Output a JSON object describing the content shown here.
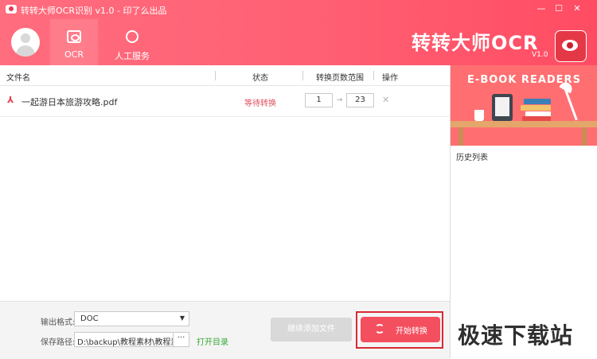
{
  "window": {
    "title": "转转大师OCR识别 v1.0 - 印了么出品",
    "controls": {
      "minimize": "—",
      "maximize": "☐",
      "close": "✕"
    }
  },
  "nav": {
    "items": [
      {
        "label": "OCR",
        "icon": "ocr-icon",
        "active": true
      },
      {
        "label": "人工服务",
        "icon": "customer-service-icon",
        "active": false
      }
    ]
  },
  "brand": {
    "name": "转转大师OCR",
    "version": "V1.0"
  },
  "table": {
    "headers": {
      "file_name": "文件名",
      "status": "状态",
      "page_range": "转换页数范围",
      "action": "操作"
    },
    "rows": [
      {
        "file_name": "一起游日本旅游攻略.pdf",
        "status": "等待转换",
        "page_from": "1",
        "page_to": "23"
      }
    ]
  },
  "settings": {
    "format_label": "输出格式:",
    "format_value": "DOC",
    "path_label": "保存路径:",
    "path_value": "D:\\backup\\教程素材\\教程素材",
    "path_more": "···",
    "open_dir": "打开目录"
  },
  "buttons": {
    "add_files": "继续添加文件",
    "start": "开始转换"
  },
  "side": {
    "banner_title": "E-BOOK READERS",
    "history_label": "历史列表"
  },
  "watermark": "极速下载站",
  "colors": {
    "header": "#ff5f73",
    "accent": "#f44f5f",
    "highlight_border": "#d82a34",
    "link": "#3aa83a"
  }
}
